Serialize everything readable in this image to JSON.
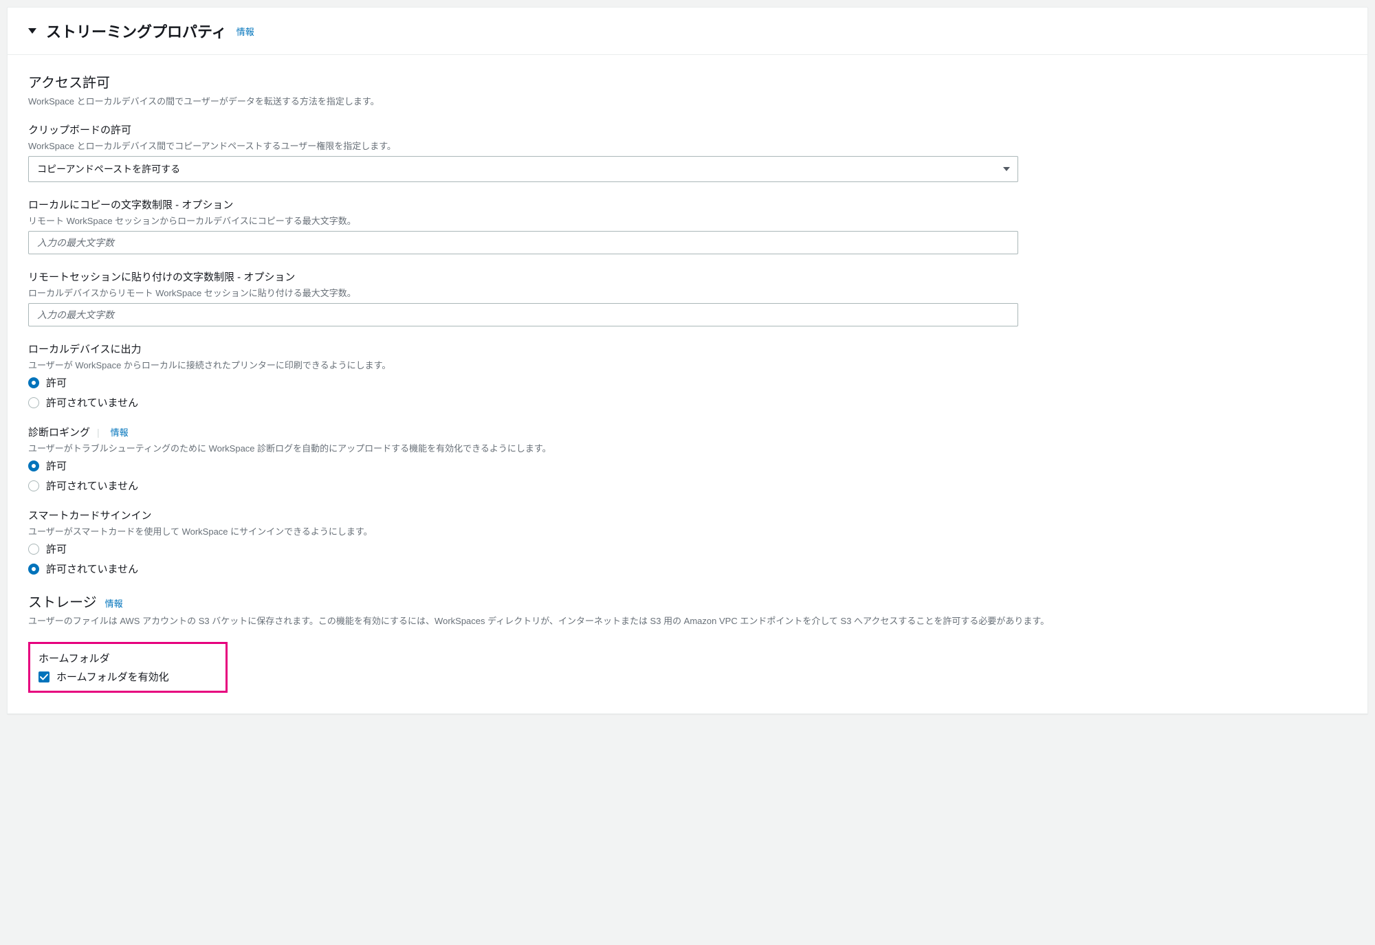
{
  "header": {
    "title": "ストリーミングプロパティ",
    "info": "情報"
  },
  "access": {
    "title": "アクセス許可",
    "desc": "WorkSpace とローカルデバイスの間でユーザーがデータを転送する方法を指定します。"
  },
  "clipboard": {
    "label": "クリップボードの許可",
    "hint": "WorkSpace とローカルデバイス間でコピーアンドペーストするユーザー権限を指定します。",
    "selected": "コピーアンドペーストを許可する"
  },
  "copyLimit": {
    "label": "ローカルにコピーの文字数制限 - オプション",
    "hint": "リモート WorkSpace セッションからローカルデバイスにコピーする最大文字数。",
    "placeholder": "入力の最大文字数"
  },
  "pasteLimit": {
    "label": "リモートセッションに貼り付けの文字数制限 - オプション",
    "hint": "ローカルデバイスからリモート WorkSpace セッションに貼り付ける最大文字数。",
    "placeholder": "入力の最大文字数"
  },
  "localPrint": {
    "label": "ローカルデバイスに出力",
    "hint": "ユーザーが WorkSpace からローカルに接続されたプリンターに印刷できるようにします。",
    "allow": "許可",
    "deny": "許可されていません"
  },
  "diagnostics": {
    "label": "診断ロギング",
    "info": "情報",
    "hint": "ユーザーがトラブルシューティングのために WorkSpace 診断ログを自動的にアップロードする機能を有効化できるようにします。",
    "allow": "許可",
    "deny": "許可されていません"
  },
  "smartcard": {
    "label": "スマートカードサインイン",
    "hint": "ユーザーがスマートカードを使用して WorkSpace にサインインできるようにします。",
    "allow": "許可",
    "deny": "許可されていません"
  },
  "storage": {
    "title": "ストレージ",
    "info": "情報",
    "desc": "ユーザーのファイルは AWS アカウントの S3 バケットに保存されます。この機能を有効にするには、WorkSpaces ディレクトリが、インターネットまたは S3 用の Amazon VPC エンドポイントを介して S3 へアクセスすることを許可する必要があります。"
  },
  "homeFolder": {
    "label": "ホームフォルダ",
    "checkbox": "ホームフォルダを有効化"
  }
}
